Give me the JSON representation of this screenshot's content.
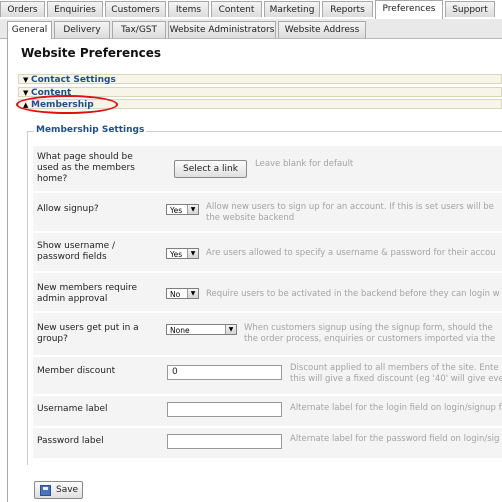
{
  "main_tabs": [
    "Orders",
    "Enquiries",
    "Customers",
    "Items",
    "Content",
    "Marketing",
    "Reports",
    "Preferences",
    "Support"
  ],
  "active_main_tab": "Preferences",
  "sub_tabs": [
    "General",
    "Delivery",
    "Tax/GST",
    "Website Administrators",
    "Website Address"
  ],
  "active_sub_tab": "General",
  "page_title": "Website Preferences",
  "sections": {
    "contact": "Contact Settings",
    "content": "Content",
    "membership": "Membership"
  },
  "membership": {
    "legend": "Membership Settings",
    "home_label": "What page should be used as the members home?",
    "home_button": "Select a link",
    "home_help": "Leave blank for default",
    "signup_label": "Allow signup?",
    "signup_value": "Yes",
    "signup_help_1": "Allow new users to sign up for an account. If this is set users will be",
    "signup_help_2": "the website backend",
    "showpw_label": "Show username / password fields",
    "showpw_value": "Yes",
    "showpw_help": "Are users allowed to specify a username & password for their accou",
    "approval_label": "New members require admin approval",
    "approval_value": "No",
    "approval_help": "Require users to be activated in the backend before they can login w",
    "group_label": "New users get put in a group?",
    "group_value": "None",
    "group_help_1": "When customers signup using the signup form, should the",
    "group_help_2": "the order process, enquiries or customers imported via the",
    "discount_label": "Member discount",
    "discount_value": "0",
    "discount_help_1": "Discount applied to all members of the site. Ente",
    "discount_help_2": "this will give a fixed discount (eg '40' will give eve",
    "username_label": "Username label",
    "username_help": "Alternate label for the login field on login/signup f",
    "password_label": "Password label",
    "password_help": "Alternate label for the password field on login/sig"
  },
  "save_label": "Save"
}
